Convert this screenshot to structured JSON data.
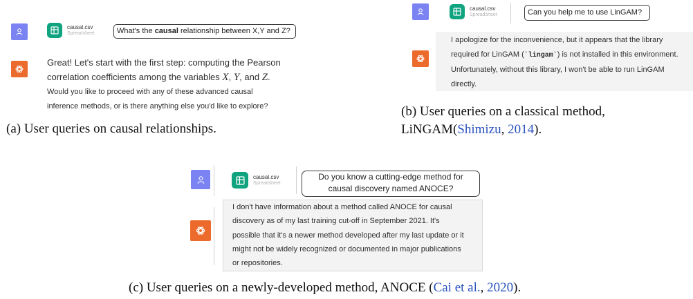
{
  "file": {
    "name": "causal.csv",
    "type": "Spreadsheet"
  },
  "panel_a": {
    "query_before": "What's the ",
    "query_bold": "causal",
    "query_after": " relationship between X,Y and Z?",
    "reply_line1": "Great! Let's start with the first step: computing the Pearson",
    "reply_line2_pre": "correlation coefficients among the variables ",
    "var_x": "X",
    "sep1": ", ",
    "var_y": "Y",
    "sep2": ", and ",
    "var_z": "Z",
    "period": ".",
    "reply_line3": "Would you like to proceed with any of these advanced causal",
    "reply_line4": "inference methods, or is there anything else you'd like to explore?",
    "caption": "(a) User queries on causal relationships."
  },
  "panel_b": {
    "query": "Can you help me to use LinGAM?",
    "reply_line1": "I apologize for the inconvenience, but it appears that the library",
    "reply_line2_pre": "required for LinGAM (",
    "reply_code": "`lingam`",
    "reply_line2_post": ") is not installed in this environment.",
    "reply_line3": "Unfortunately, without this library, I won't be able to run LinGAM",
    "reply_line4": "directly.",
    "caption_line1": "(b) User queries on a classical method,",
    "caption_line2_pre": "LiNGAM(",
    "caption_cite_author": "Shimizu",
    "caption_cite_sep": ", ",
    "caption_cite_year": "2014",
    "caption_line2_post": ")."
  },
  "panel_c": {
    "query_line1": "Do you know a cutting-edge method for",
    "query_line2": "causal discovery named ANOCE?",
    "reply_line1": "I don't have information about a method called ANOCE for causal",
    "reply_line2": "discovery as of my last training cut-off in September 2021. It's",
    "reply_line3": "possible that it's a newer method developed after my last update or it",
    "reply_line4": "might not be widely recognized or documented in major publications",
    "reply_line5": "or repositories.",
    "caption_pre": "(c) User queries on a newly-developed method, ANOCE (",
    "caption_cite_author": "Cai et al.",
    "caption_cite_sep": ", ",
    "caption_cite_year": "2020",
    "caption_post": ")."
  }
}
